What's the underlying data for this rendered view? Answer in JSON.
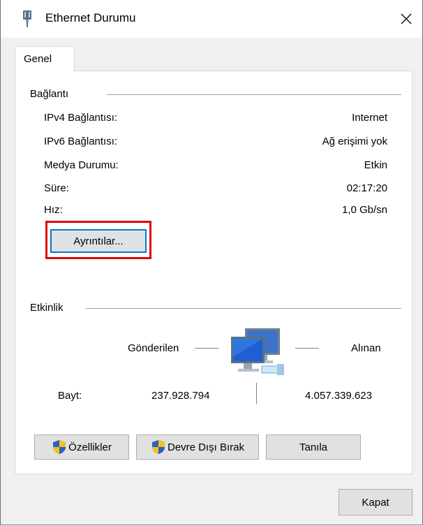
{
  "window": {
    "title": "Ethernet Durumu",
    "icon": "network-adapter-icon"
  },
  "tabs": [
    {
      "label": "Genel",
      "selected": true
    }
  ],
  "connection": {
    "group_label": "Bağlantı",
    "rows": [
      {
        "label": "IPv4 Bağlantısı:",
        "value": "Internet"
      },
      {
        "label": "IPv6 Bağlantısı:",
        "value": "Ağ erişimi yok"
      },
      {
        "label": "Medya Durumu:",
        "value": "Etkin"
      },
      {
        "label": "Süre:",
        "value": "02:17:20"
      },
      {
        "label": "Hız:",
        "value": "1,0 Gb/sn"
      }
    ],
    "details_button": "Ayrıntılar..."
  },
  "activity": {
    "group_label": "Etkinlik",
    "sent_label": "Gönderilen",
    "received_label": "Alınan",
    "bytes_label": "Bayt:",
    "bytes_sent": "237.928.794",
    "bytes_received": "4.057.339.623"
  },
  "buttons": {
    "properties": "Özellikler",
    "disable": "Devre Dışı Bırak",
    "diagnose": "Tanıla",
    "close": "Kapat"
  },
  "colors": {
    "highlight": "#e00000",
    "focus": "#0078d7"
  }
}
